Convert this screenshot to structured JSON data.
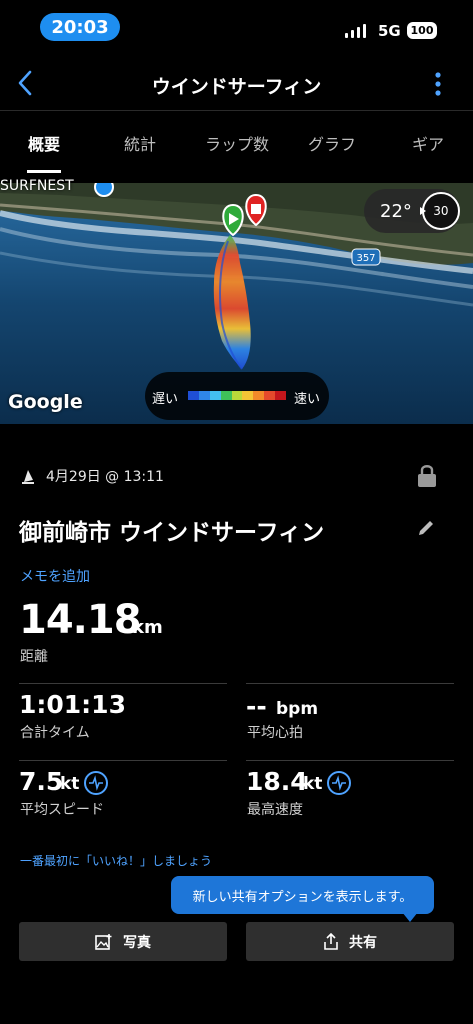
{
  "status": {
    "time": "20:03",
    "network": "5G",
    "battery": "100"
  },
  "header": {
    "title": "ウインドサーフィン"
  },
  "tabs": [
    {
      "label": "概要"
    },
    {
      "label": "統計"
    },
    {
      "label": "ラップ数"
    },
    {
      "label": "グラフ"
    },
    {
      "label": "ギア"
    }
  ],
  "map": {
    "place_label": "SURFNEST",
    "road_number": "357",
    "attribution": "Google",
    "temperature": "22°",
    "wind_speed": "30",
    "legend": {
      "slow": "遅い",
      "fast": "速い",
      "colors": [
        "#1f4fd6",
        "#2f86e8",
        "#43c0f0",
        "#3fc25a",
        "#b9d93a",
        "#f4c535",
        "#f28a2a",
        "#e54a2c",
        "#c4161c"
      ]
    }
  },
  "activity": {
    "date": "4月29日 @ 13:11",
    "title": "御前崎市 ウインドサーフィン",
    "memo_link": "メモを追加"
  },
  "stats": {
    "distance": {
      "value": "14.18",
      "unit": "km",
      "label": "距離"
    },
    "total_time": {
      "value": "1:01:13",
      "label": "合計タイム"
    },
    "avg_hr": {
      "value": "--",
      "unit": "bpm",
      "label": "平均心拍"
    },
    "avg_speed": {
      "value": "7.5",
      "unit": "kt",
      "label": "平均スピード"
    },
    "max_speed": {
      "value": "18.4",
      "unit": "kt",
      "label": "最高速度"
    }
  },
  "like_prompt": "一番最初に「いいね！」しましょう",
  "tooltip": "新しい共有オプションを表示します。",
  "buttons": {
    "photo": "写真",
    "share": "共有"
  },
  "colors": {
    "accent": "#1e8ef0",
    "link": "#4fa3ff",
    "tooltip": "#1e76d8"
  }
}
